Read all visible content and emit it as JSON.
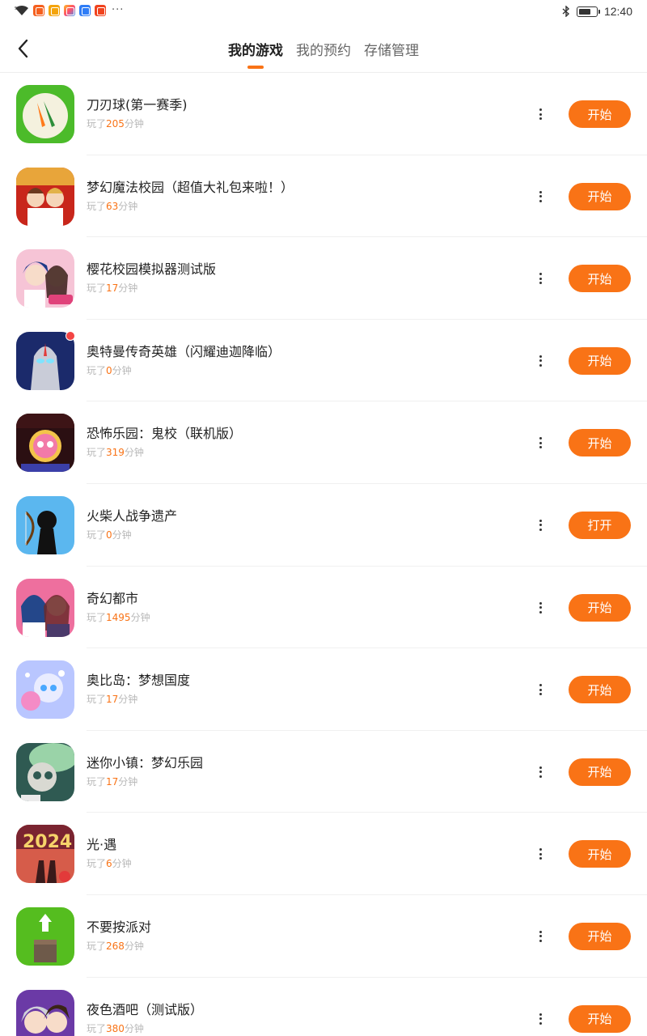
{
  "status_bar": {
    "time": "12:40",
    "notification_icons": [
      "wifi-icon",
      "app-notification-icon",
      "app-notification-icon",
      "app-notification-icon",
      "app-notification-icon",
      "app-notification-icon"
    ],
    "more_indicator": "···"
  },
  "header": {
    "tabs": [
      {
        "label": "我的游戏",
        "active": true
      },
      {
        "label": "我的预约",
        "active": false
      },
      {
        "label": "存储管理",
        "active": false
      }
    ]
  },
  "accent_color": "#f97316",
  "games": [
    {
      "title": "刀刃球(第一赛季)",
      "prefix": "玩了",
      "minutes": "205",
      "suffix": "分钟",
      "button": "开始",
      "badge": false
    },
    {
      "title": "梦幻魔法校园（超值大礼包来啦！）",
      "prefix": "玩了",
      "minutes": "63",
      "suffix": "分钟",
      "button": "开始",
      "badge": false
    },
    {
      "title": "樱花校园模拟器测试版",
      "prefix": "玩了",
      "minutes": "17",
      "suffix": "分钟",
      "button": "开始",
      "badge": false
    },
    {
      "title": "奥特曼传奇英雄（闪耀迪迦降临）",
      "prefix": "玩了",
      "minutes": "0",
      "suffix": "分钟",
      "button": "开始",
      "badge": true
    },
    {
      "title": "恐怖乐园：鬼校（联机版）",
      "prefix": "玩了",
      "minutes": "319",
      "suffix": "分钟",
      "button": "开始",
      "badge": false
    },
    {
      "title": "火柴人战争遗产",
      "prefix": "玩了",
      "minutes": "0",
      "suffix": "分钟",
      "button": "打开",
      "badge": false
    },
    {
      "title": "奇幻都市",
      "prefix": "玩了",
      "minutes": "1495",
      "suffix": "分钟",
      "button": "开始",
      "badge": false
    },
    {
      "title": "奥比岛：梦想国度",
      "prefix": "玩了",
      "minutes": "17",
      "suffix": "分钟",
      "button": "开始",
      "badge": false
    },
    {
      "title": "迷你小镇：梦幻乐园",
      "prefix": "玩了",
      "minutes": "17",
      "suffix": "分钟",
      "button": "开始",
      "badge": false
    },
    {
      "title": "光·遇",
      "prefix": "玩了",
      "minutes": "6",
      "suffix": "分钟",
      "button": "开始",
      "badge": false
    },
    {
      "title": "不要按派对",
      "prefix": "玩了",
      "minutes": "268",
      "suffix": "分钟",
      "button": "开始",
      "badge": false
    },
    {
      "title": "夜色酒吧（测试版）",
      "prefix": "玩了",
      "minutes": "380",
      "suffix": "分钟",
      "button": "开始",
      "badge": false
    }
  ]
}
